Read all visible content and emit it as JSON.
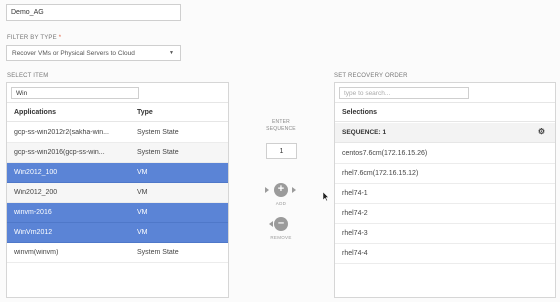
{
  "name_field": {
    "value": "Demo_AG"
  },
  "filter": {
    "label": "FILTER BY TYPE",
    "required_mark": "*",
    "selected": "Recover VMs or Physical Servers to Cloud"
  },
  "select_item": {
    "label": "SELECT ITEM",
    "search_value": "Win",
    "columns": {
      "app": "Applications",
      "type": "Type"
    },
    "rows": [
      {
        "app": "gcp-ss-win2012r2(sakha-win...",
        "type": "System State",
        "selected": false
      },
      {
        "app": "gcp-ss-win2016(gcp-ss-win...",
        "type": "System State",
        "selected": false
      },
      {
        "app": "Win2012_100",
        "type": "VM",
        "selected": true
      },
      {
        "app": "Win2012_200",
        "type": "VM",
        "selected": false
      },
      {
        "app": "winvm-2016",
        "type": "VM",
        "selected": true
      },
      {
        "app": "WinVm2012",
        "type": "VM",
        "selected": true
      },
      {
        "app": "winvm(winvm)",
        "type": "System State",
        "selected": false
      }
    ]
  },
  "center": {
    "enter_label_1": "ENTER",
    "enter_label_2": "SEQUENCE",
    "sequence_value": "1",
    "add_label": "ADD",
    "remove_label": "REMOVE"
  },
  "recovery_order": {
    "label": "SET RECOVERY ORDER",
    "search_placeholder": "type to search...",
    "header": "Selections",
    "sequence_label": "SEQUENCE: 1",
    "items": [
      "centos7.6cm(172.16.15.26)",
      "rhel7.6cm(172.16.15.12)",
      "rhel74-1",
      "rhel74-2",
      "rhel74-3",
      "rhel74-4"
    ]
  },
  "colors": {
    "selected_row": "#5b84d6",
    "required": "#e05a3a",
    "button_gray": "#9b9b9b"
  },
  "icons": {
    "dropdown": "caret-down-icon",
    "add": "plus-icon",
    "remove": "minus-icon",
    "settings": "gear-icon",
    "pointer": "cursor-icon"
  }
}
